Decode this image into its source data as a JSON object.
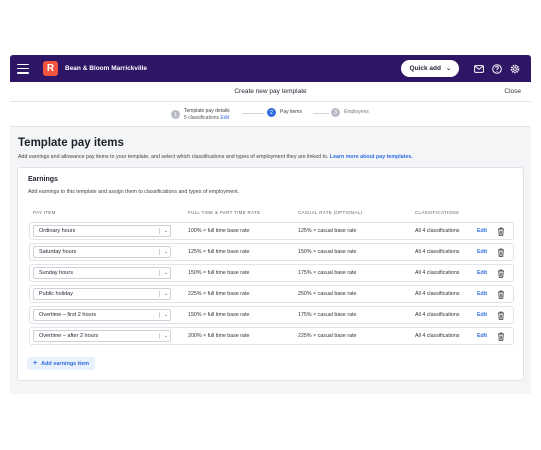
{
  "topbar": {
    "logo_letter": "R",
    "business_name": "Bean & Bloom Marrickville",
    "quick_add_label": "Quick add",
    "icons": [
      "mail-icon",
      "help-icon",
      "settings-icon"
    ]
  },
  "subheader": {
    "title": "Create new pay template",
    "close_label": "Close"
  },
  "steps": [
    {
      "num": "1",
      "label": "Template pay details",
      "sub": "5 classifications",
      "edit": "Edit",
      "state": "done"
    },
    {
      "num": "2",
      "label": "Pay items",
      "state": "active"
    },
    {
      "num": "3",
      "label": "Employees",
      "state": "pending"
    }
  ],
  "page": {
    "title": "Template pay items",
    "description": "Add earnings and allowance pay items to your template, and select which classifications and types of employment they are linked to.",
    "learn_more": "Learn more about pay templates."
  },
  "earnings": {
    "title": "Earnings",
    "description": "Add earnings to this template and assign them to classifications and types of employment.",
    "columns": [
      "PAY ITEM",
      "FULL TIME & PART TIME RATE",
      "CASUAL RATE (OPTIONAL)",
      "CLASSIFICATIONS"
    ],
    "rows": [
      {
        "item": "Ordinary hours",
        "ftpt": "100% × full time base rate",
        "casual": "125% × casual base rate",
        "classifications": "All 4 classifications",
        "edit": "Edit"
      },
      {
        "item": "Saturday hours",
        "ftpt": "125% × full time base rate",
        "casual": "150% × casual base rate",
        "classifications": "All 4 classifications",
        "edit": "Edit"
      },
      {
        "item": "Sunday hours",
        "ftpt": "150% × full time base rate",
        "casual": "175% × casual base rate",
        "classifications": "All 4 classifications",
        "edit": "Edit"
      },
      {
        "item": "Public holiday",
        "ftpt": "225% × full time base rate",
        "casual": "250% × casual base rate",
        "classifications": "All 4 classifications",
        "edit": "Edit"
      },
      {
        "item": "Overtime – first 2 hours",
        "ftpt": "150% × full time base rate",
        "casual": "175% × casual base rate",
        "classifications": "All 4 classifications",
        "edit": "Edit"
      },
      {
        "item": "Overtime – after 2 hours",
        "ftpt": "200% × full time base rate",
        "casual": "225% × casual base rate",
        "classifications": "All 4 classifications",
        "edit": "Edit"
      }
    ],
    "add_label": "Add earnings item"
  },
  "colors": {
    "topbar": "#2e1566",
    "accent": "#2f6de1",
    "logo": "#f2553f"
  }
}
